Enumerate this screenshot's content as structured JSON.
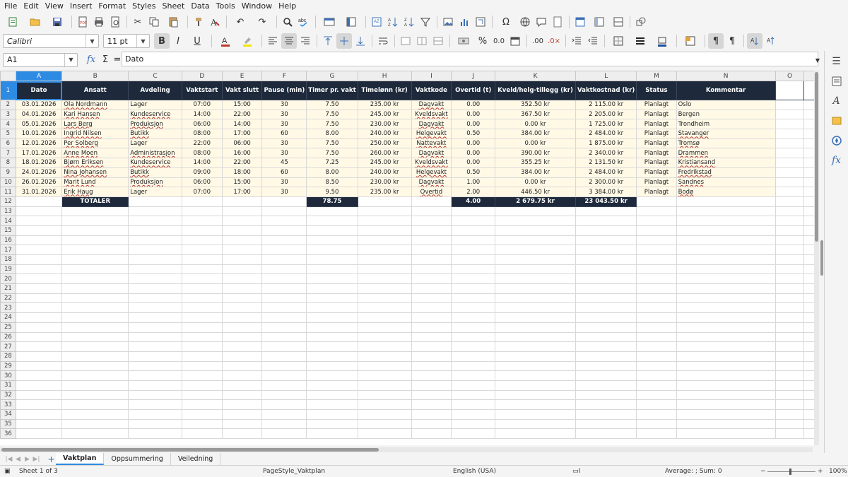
{
  "menu": [
    "File",
    "Edit",
    "View",
    "Insert",
    "Format",
    "Styles",
    "Sheet",
    "Data",
    "Tools",
    "Window",
    "Help"
  ],
  "font": {
    "name": "Calibri",
    "size": "11 pt"
  },
  "namebox": "A1",
  "formula": {
    "content": "Dato",
    "fx_symbol": "fx",
    "sum_symbol": "Σ",
    "eq_symbol": "="
  },
  "columns": [
    "A",
    "B",
    "C",
    "D",
    "E",
    "F",
    "G",
    "H",
    "I",
    "J",
    "K",
    "L",
    "M",
    "N",
    "O"
  ],
  "headers": [
    "Dato",
    "Ansatt",
    "Avdeling",
    "Vaktstart",
    "Vakt slutt",
    "Pause (min)",
    "Timer pr. vakt",
    "Timelønn (kr)",
    "Vaktkode",
    "Overtid (t)",
    "Kveld/helg-tillegg (kr)",
    "Vaktkostnad (kr)",
    "Status",
    "Kommentar"
  ],
  "rows": [
    [
      "03.01.2026",
      "Ola Nordmann",
      "Lager",
      "07:00",
      "15:00",
      "30",
      "7.50",
      "235.00 kr",
      "Dagvakt",
      "0.00",
      "352.50 kr",
      "2 115.00 kr",
      "Planlagt",
      "Oslo"
    ],
    [
      "04.01.2026",
      "Kari Hansen",
      "Kundeservice",
      "14:00",
      "22:00",
      "30",
      "7.50",
      "245.00 kr",
      "Kveldsvakt",
      "0.00",
      "367.50 kr",
      "2 205.00 kr",
      "Planlagt",
      "Bergen"
    ],
    [
      "05.01.2026",
      "Lars Berg",
      "Produksjon",
      "06:00",
      "14:00",
      "30",
      "7.50",
      "230.00 kr",
      "Dagvakt",
      "0.00",
      "0.00 kr",
      "1 725.00 kr",
      "Planlagt",
      "Trondheim"
    ],
    [
      "10.01.2026",
      "Ingrid Nilsen",
      "Butikk",
      "08:00",
      "17:00",
      "60",
      "8.00",
      "240.00 kr",
      "Helgevakt",
      "0.50",
      "384.00 kr",
      "2 484.00 kr",
      "Planlagt",
      "Stavanger"
    ],
    [
      "12.01.2026",
      "Per Solberg",
      "Lager",
      "22:00",
      "06:00",
      "30",
      "7.50",
      "250.00 kr",
      "Nattevakt",
      "0.00",
      "0.00 kr",
      "1 875.00 kr",
      "Planlagt",
      "Tromsø"
    ],
    [
      "17.01.2026",
      "Anne Moen",
      "Administrasjon",
      "08:00",
      "16:00",
      "30",
      "7.50",
      "260.00 kr",
      "Dagvakt",
      "0.00",
      "390.00 kr",
      "2 340.00 kr",
      "Planlagt",
      "Drammen"
    ],
    [
      "18.01.2026",
      "Bjørn Eriksen",
      "Kundeservice",
      "14:00",
      "22:00",
      "45",
      "7.25",
      "245.00 kr",
      "Kveldsvakt",
      "0.00",
      "355.25 kr",
      "2 131.50 kr",
      "Planlagt",
      "Kristiansand"
    ],
    [
      "24.01.2026",
      "Nina Johansen",
      "Butikk",
      "09:00",
      "18:00",
      "60",
      "8.00",
      "240.00 kr",
      "Helgevakt",
      "0.50",
      "384.00 kr",
      "2 484.00 kr",
      "Planlagt",
      "Fredrikstad"
    ],
    [
      "26.01.2026",
      "Marit Lund",
      "Produksjon",
      "06:00",
      "15:00",
      "30",
      "8.50",
      "230.00 kr",
      "Dagvakt",
      "1.00",
      "0.00 kr",
      "2 300.00 kr",
      "Planlagt",
      "Sandnes"
    ],
    [
      "31.01.2026",
      "Erik Haug",
      "Lager",
      "07:00",
      "17:00",
      "30",
      "9.50",
      "235.00 kr",
      "Overtid",
      "2.00",
      "446.50 kr",
      "3 384.00 kr",
      "Planlagt",
      "Bodø"
    ]
  ],
  "totals": {
    "label": "TOTALER",
    "hours": "78.75",
    "overtime": "4.00",
    "supplement": "2 679.75 kr",
    "cost": "23 043.50 kr"
  },
  "tabs": [
    "Vaktplan",
    "Oppsummering",
    "Veiledning"
  ],
  "status": {
    "sheet": "Sheet 1 of 3",
    "pagestyle": "PageStyle_Vaktplan",
    "language": "English (USA)",
    "sum": "Average: ; Sum: 0",
    "zoom": "100%"
  },
  "colors": {
    "header_bg": "#1e2a3c",
    "data_bg": "#fff9e6",
    "selection": "#2d8be4"
  }
}
